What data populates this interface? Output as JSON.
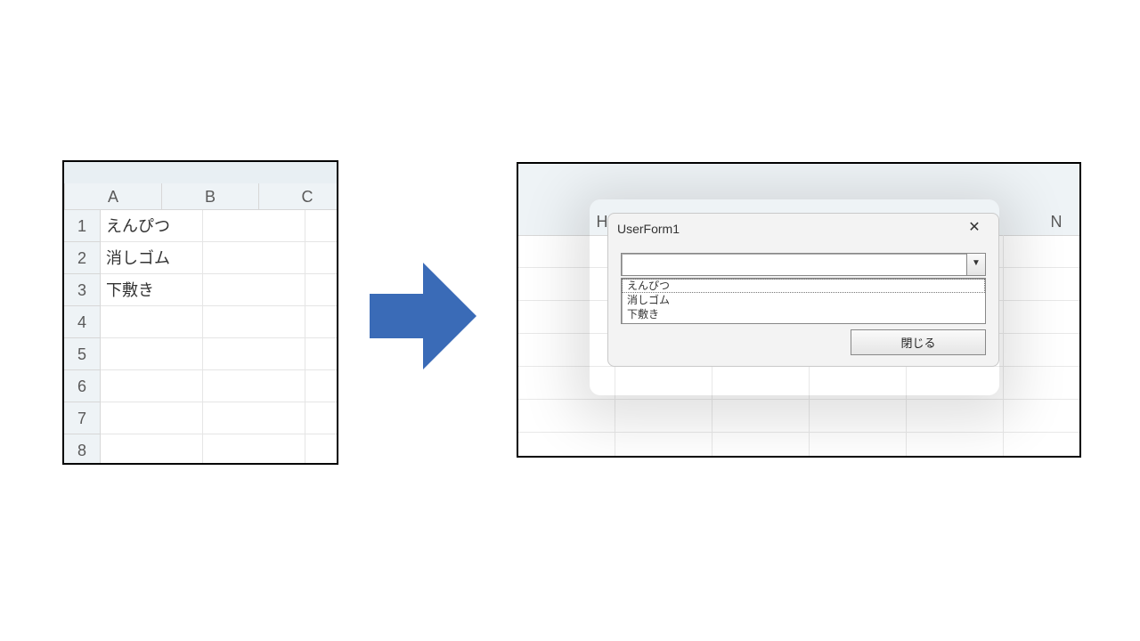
{
  "sheet": {
    "columns": [
      "A",
      "B",
      "C"
    ],
    "rows": [
      "1",
      "2",
      "3",
      "4",
      "5",
      "6",
      "7",
      "8"
    ],
    "cells": {
      "A1": "えんぴつ",
      "A2": "消しゴム",
      "A3": "下敷き"
    }
  },
  "right_sheet": {
    "col_H": "H",
    "col_N": "N"
  },
  "form": {
    "title": "UserForm1",
    "close_icon_label": "✕",
    "combo_value": "",
    "list_items": [
      "えんぴつ",
      "消しゴム",
      "下敷き"
    ],
    "close_button_label": "閉じる"
  }
}
